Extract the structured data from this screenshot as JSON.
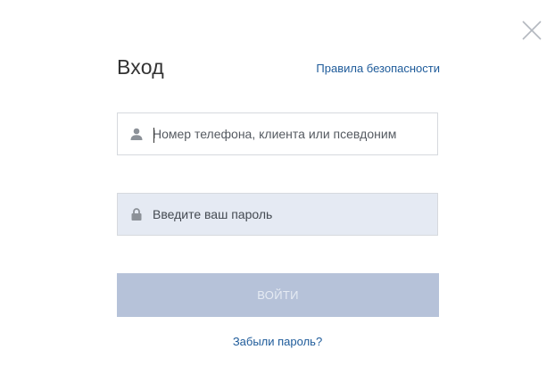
{
  "dialog": {
    "title": "Вход",
    "security_link": "Правила безопасности",
    "close_icon": "close-icon"
  },
  "form": {
    "login": {
      "placeholder": "Номер телефона, клиента или псевдоним",
      "value": "",
      "icon": "user-icon"
    },
    "password": {
      "placeholder": "Введите ваш пароль",
      "value": "",
      "icon": "lock-icon"
    },
    "submit_label": "ВОЙТИ",
    "forgot_label": "Забыли пароль?"
  },
  "colors": {
    "link": "#1e5b9a",
    "submit_bg": "#b6c2d9",
    "password_bg": "#e5eaf3"
  }
}
